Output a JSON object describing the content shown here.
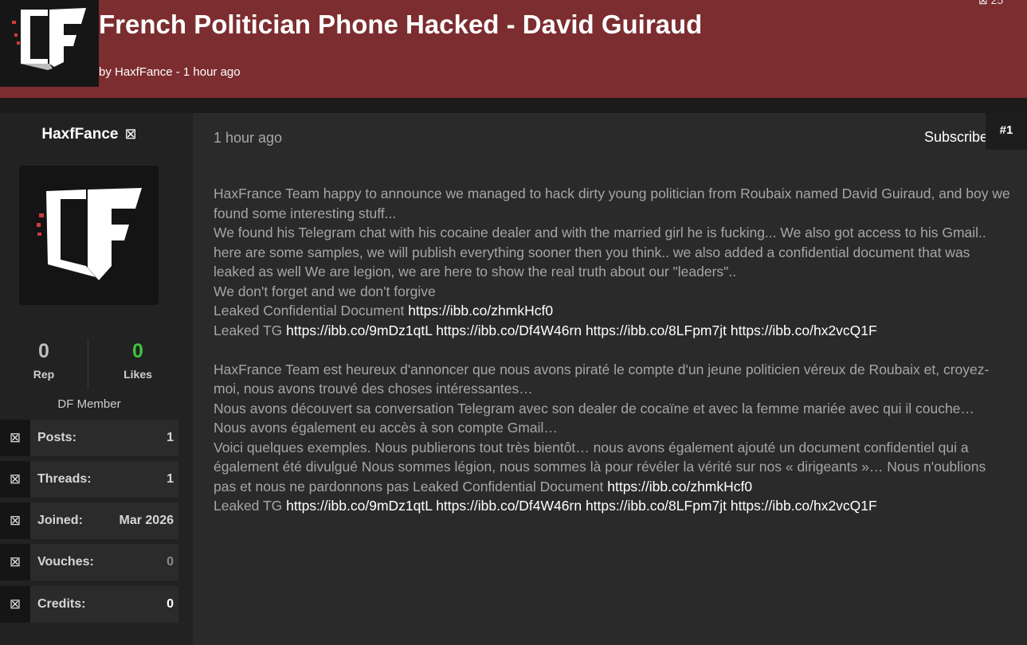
{
  "header": {
    "title": "French Politician Phone Hacked - David Guiraud",
    "byline": "by HaxfFance - 1 hour ago",
    "corner_icon": "bookmark-icon",
    "logo_text": "DF"
  },
  "author": {
    "username": "HaxfFance",
    "username_icon": "user-badge-icon",
    "rep_value": "0",
    "rep_label": "Rep",
    "likes_value": "0",
    "likes_label": "Likes",
    "role": "DF Member",
    "info": [
      {
        "icon": "posts-icon",
        "label": "Posts:",
        "value": "1"
      },
      {
        "icon": "threads-icon",
        "label": "Threads:",
        "value": "1"
      },
      {
        "icon": "calendar-icon",
        "label": "Joined:",
        "value": "Mar 2026"
      },
      {
        "icon": "vouches-icon",
        "label": "Vouches:",
        "value": "0"
      },
      {
        "icon": "credits-icon",
        "label": "Credits:",
        "value": "0"
      }
    ]
  },
  "post": {
    "time": "1 hour ago",
    "subscribe": "Subscribe",
    "number": "#1",
    "en_p1": "HaxFrance Team happy to announce we managed to hack dirty young politician from Roubaix named David Guiraud, and boy we found some interesting stuff...",
    "en_p2": "We found his Telegram chat with his cocaine dealer and with the married girl he is fucking... We also got access to his Gmail.. here are some samples, we will publish everything sooner then you think.. we also added a confidential document that was leaked as well We are legion, we are here to show the real truth about our \"leaders\"..",
    "en_p3": "We don't forget and we don't forgive",
    "en_doc_label": "Leaked Confidential Document ",
    "doc_link": "https://ibb.co/zhmkHcf0",
    "tg_label": "Leaked TG ",
    "tg_links": [
      "https://ibb.co/9mDz1qtL",
      "https://ibb.co/Df4W46rn",
      "https://ibb.co/8LFpm7jt",
      "https://ibb.co/hx2vcQ1F"
    ],
    "fr_p1": "HaxFrance Team est heureux d'annoncer que nous avons piraté le compte d'un jeune politicien véreux de Roubaix et, croyez-moi, nous avons trouvé des choses intéressantes…",
    "fr_p2": "Nous avons découvert sa conversation Telegram avec son dealer de cocaïne et avec la femme mariée avec qui il couche… Nous avons également eu accès à son compte Gmail…",
    "fr_p3": "Voici quelques exemples. Nous publierons tout très bientôt… nous avons également ajouté un document confidentiel qui a également été divulgué Nous sommes légion, nous sommes là pour révéler la vérité sur nos « dirigeants »… Nous n'oublions pas et nous ne pardonnons pas Leaked Confidential Document "
  },
  "colors": {
    "header_bg": "#7c2d2f",
    "likes_green": "#3ec43e",
    "link": "#ffffff"
  }
}
